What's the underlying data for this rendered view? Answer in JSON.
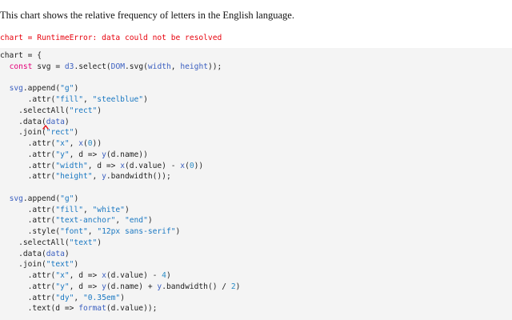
{
  "intro_text": "This chart shows the relative frequency of letters in the English language.",
  "error_text": "chart = RuntimeError: data could not be resolved",
  "colors": {
    "error": "#e7040f",
    "keyword": "#e40079",
    "function": "#3b5fc0",
    "string": "#1a78c2",
    "number": "#2a8cc6",
    "code_bg": "#f4f4f4",
    "caret": "#e7040f"
  },
  "code_lines": [
    [
      {
        "t": "chart = {",
        "c": "plain"
      }
    ],
    [
      {
        "t": "  ",
        "c": "plain"
      },
      {
        "t": "const",
        "c": "kw"
      },
      {
        "t": " svg = ",
        "c": "plain"
      },
      {
        "t": "d3",
        "c": "fn"
      },
      {
        "t": ".select(",
        "c": "plain"
      },
      {
        "t": "DOM",
        "c": "fn"
      },
      {
        "t": ".svg(",
        "c": "plain"
      },
      {
        "t": "width",
        "c": "fn"
      },
      {
        "t": ", ",
        "c": "plain"
      },
      {
        "t": "height",
        "c": "fn"
      },
      {
        "t": "));",
        "c": "plain"
      }
    ],
    [
      {
        "t": "",
        "c": "plain"
      }
    ],
    [
      {
        "t": "  ",
        "c": "plain"
      },
      {
        "t": "svg",
        "c": "fn"
      },
      {
        "t": ".append(",
        "c": "plain"
      },
      {
        "t": "\"g\"",
        "c": "str"
      },
      {
        "t": ")",
        "c": "plain"
      }
    ],
    [
      {
        "t": "      .attr(",
        "c": "plain"
      },
      {
        "t": "\"fill\"",
        "c": "str"
      },
      {
        "t": ", ",
        "c": "plain"
      },
      {
        "t": "\"steelblue\"",
        "c": "str"
      },
      {
        "t": ")",
        "c": "plain"
      }
    ],
    [
      {
        "t": "    .selectAll(",
        "c": "plain"
      },
      {
        "t": "\"rect\"",
        "c": "str"
      },
      {
        "t": ")",
        "c": "plain"
      }
    ],
    [
      {
        "t": "    .data(",
        "c": "plain"
      },
      {
        "t": "data",
        "c": "fn"
      },
      {
        "t": ")",
        "c": "plain"
      }
    ],
    [
      {
        "t": "    .join(",
        "c": "plain"
      },
      {
        "t": "\"rect\"",
        "c": "str"
      },
      {
        "t": ")",
        "c": "plain"
      }
    ],
    [
      {
        "t": "      .attr(",
        "c": "plain"
      },
      {
        "t": "\"x\"",
        "c": "str"
      },
      {
        "t": ", ",
        "c": "plain"
      },
      {
        "t": "x",
        "c": "fn"
      },
      {
        "t": "(",
        "c": "plain"
      },
      {
        "t": "0",
        "c": "num"
      },
      {
        "t": "))",
        "c": "plain"
      }
    ],
    [
      {
        "t": "      .attr(",
        "c": "plain"
      },
      {
        "t": "\"y\"",
        "c": "str"
      },
      {
        "t": ", d => ",
        "c": "plain"
      },
      {
        "t": "y",
        "c": "fn"
      },
      {
        "t": "(d.name))",
        "c": "plain"
      }
    ],
    [
      {
        "t": "      .attr(",
        "c": "plain"
      },
      {
        "t": "\"width\"",
        "c": "str"
      },
      {
        "t": ", d => ",
        "c": "plain"
      },
      {
        "t": "x",
        "c": "fn"
      },
      {
        "t": "(d.value) - ",
        "c": "plain"
      },
      {
        "t": "x",
        "c": "fn"
      },
      {
        "t": "(",
        "c": "plain"
      },
      {
        "t": "0",
        "c": "num"
      },
      {
        "t": "))",
        "c": "plain"
      }
    ],
    [
      {
        "t": "      .attr(",
        "c": "plain"
      },
      {
        "t": "\"height\"",
        "c": "str"
      },
      {
        "t": ", ",
        "c": "plain"
      },
      {
        "t": "y",
        "c": "fn"
      },
      {
        "t": ".bandwidth());",
        "c": "plain"
      }
    ],
    [
      {
        "t": "",
        "c": "plain"
      }
    ],
    [
      {
        "t": "  ",
        "c": "plain"
      },
      {
        "t": "svg",
        "c": "fn"
      },
      {
        "t": ".append(",
        "c": "plain"
      },
      {
        "t": "\"g\"",
        "c": "str"
      },
      {
        "t": ")",
        "c": "plain"
      }
    ],
    [
      {
        "t": "      .attr(",
        "c": "plain"
      },
      {
        "t": "\"fill\"",
        "c": "str"
      },
      {
        "t": ", ",
        "c": "plain"
      },
      {
        "t": "\"white\"",
        "c": "str"
      },
      {
        "t": ")",
        "c": "plain"
      }
    ],
    [
      {
        "t": "      .attr(",
        "c": "plain"
      },
      {
        "t": "\"text-anchor\"",
        "c": "str"
      },
      {
        "t": ", ",
        "c": "plain"
      },
      {
        "t": "\"end\"",
        "c": "str"
      },
      {
        "t": ")",
        "c": "plain"
      }
    ],
    [
      {
        "t": "      .style(",
        "c": "plain"
      },
      {
        "t": "\"font\"",
        "c": "str"
      },
      {
        "t": ", ",
        "c": "plain"
      },
      {
        "t": "\"12px sans-serif\"",
        "c": "str"
      },
      {
        "t": ")",
        "c": "plain"
      }
    ],
    [
      {
        "t": "    .selectAll(",
        "c": "plain"
      },
      {
        "t": "\"text\"",
        "c": "str"
      },
      {
        "t": ")",
        "c": "plain"
      }
    ],
    [
      {
        "t": "    .data(",
        "c": "plain"
      },
      {
        "t": "data",
        "c": "fn"
      },
      {
        "t": ")",
        "c": "plain"
      }
    ],
    [
      {
        "t": "    .join(",
        "c": "plain"
      },
      {
        "t": "\"text\"",
        "c": "str"
      },
      {
        "t": ")",
        "c": "plain"
      }
    ],
    [
      {
        "t": "      .attr(",
        "c": "plain"
      },
      {
        "t": "\"x\"",
        "c": "str"
      },
      {
        "t": ", d => ",
        "c": "plain"
      },
      {
        "t": "x",
        "c": "fn"
      },
      {
        "t": "(d.value) - ",
        "c": "plain"
      },
      {
        "t": "4",
        "c": "num"
      },
      {
        "t": ")",
        "c": "plain"
      }
    ],
    [
      {
        "t": "      .attr(",
        "c": "plain"
      },
      {
        "t": "\"y\"",
        "c": "str"
      },
      {
        "t": ", d => ",
        "c": "plain"
      },
      {
        "t": "y",
        "c": "fn"
      },
      {
        "t": "(d.name) + ",
        "c": "plain"
      },
      {
        "t": "y",
        "c": "fn"
      },
      {
        "t": ".bandwidth() / ",
        "c": "plain"
      },
      {
        "t": "2",
        "c": "num"
      },
      {
        "t": ")",
        "c": "plain"
      }
    ],
    [
      {
        "t": "      .attr(",
        "c": "plain"
      },
      {
        "t": "\"dy\"",
        "c": "str"
      },
      {
        "t": ", ",
        "c": "plain"
      },
      {
        "t": "\"0.35em\"",
        "c": "str"
      },
      {
        "t": ")",
        "c": "plain"
      }
    ],
    [
      {
        "t": "      .text(d => ",
        "c": "plain"
      },
      {
        "t": "format",
        "c": "fn"
      },
      {
        "t": "(d.value));",
        "c": "plain"
      }
    ]
  ]
}
